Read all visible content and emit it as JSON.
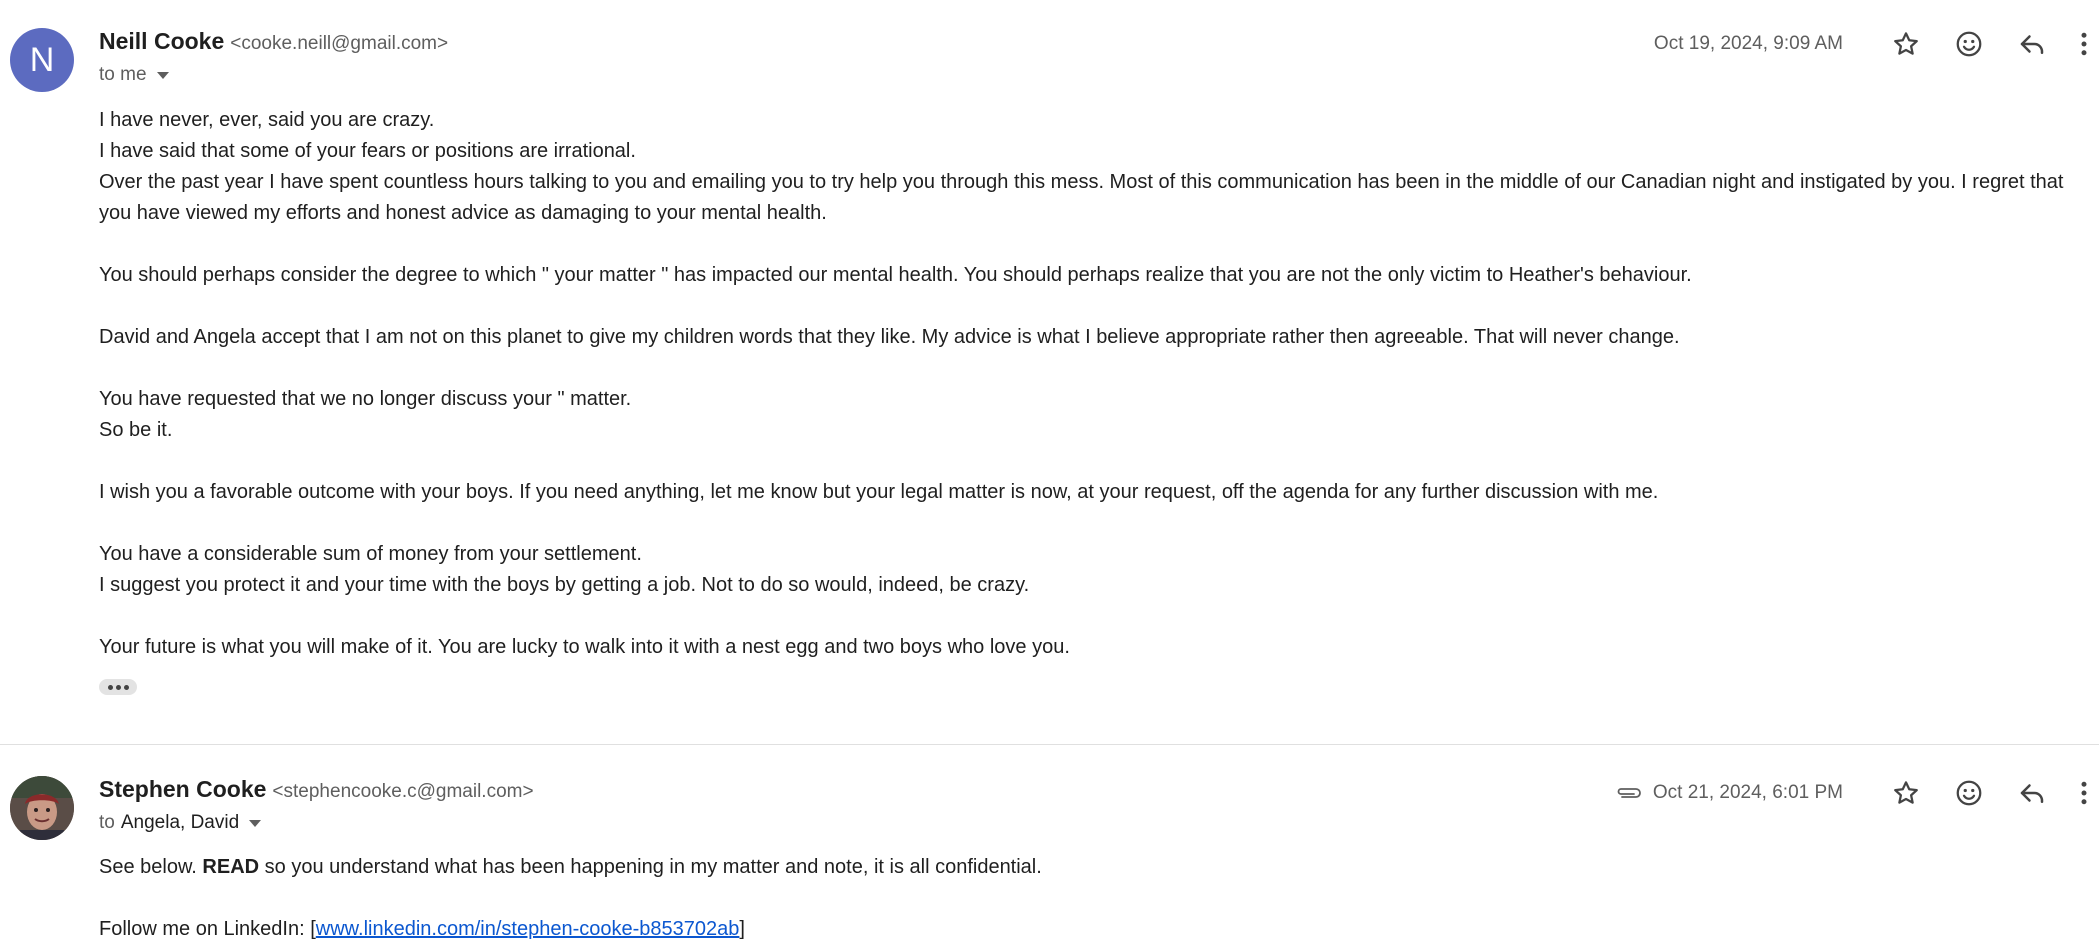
{
  "messages": [
    {
      "avatar_letter": "N",
      "sender_name": "Neill Cooke",
      "sender_email": "<cooke.neill@gmail.com>",
      "to_prefix": "to me",
      "date": "Oct 19, 2024, 9:09 AM",
      "body": {
        "l1": "I have never, ever, said you are crazy.",
        "l2": "I have said that some of your fears or positions are irrational.",
        "l3": "Over the past year I have spent countless hours talking to you and emailing you to try help you through this mess. Most of this communication has been in the middle of our Canadian night and instigated by you. I regret that you have viewed my efforts and honest advice as damaging to your mental health.",
        "l4": "You should perhaps consider the degree to which \" your matter \"  has impacted our mental health.  You should  perhaps realize that you are not the only victim to Heather's behaviour.",
        "l5": "David and Angela accept that I am not on this planet to give my children words that they like. My advice is what I believe appropriate rather then agreeable. That will never change.",
        "l6": "You have requested that we no longer discuss your \" matter.",
        "l7": "So be it.",
        "l8": "I wish you a favorable outcome with your boys. If you need anything, let me know but your legal matter is now, at your request, off the agenda for any further discussion with me.",
        "l9": "You have a considerable sum of money from your settlement.",
        "l10": "I suggest you protect it and your time with the boys by getting a job. Not to do so would, indeed, be crazy.",
        "l11": "Your future is what you will make of it. You are lucky to walk into it with a nest egg and two boys who love you."
      }
    },
    {
      "sender_name": "Stephen Cooke",
      "sender_email": "<stephencooke.c@gmail.com>",
      "to_prefix": "to",
      "to_recipients": "Angela, David",
      "date": "Oct 21, 2024, 6:01 PM",
      "body": {
        "l1_pre": "See below. ",
        "l1_bold": "READ",
        "l1_post": " so you understand what has been happening in my matter and note, it is all confidential.",
        "l2_pre": "Follow me on LinkedIn: [",
        "l2_link": "www.linkedin.com/in/stephen-cooke-b853702ab",
        "l2_post": "]"
      }
    }
  ],
  "icons": {
    "star": "star-icon",
    "emoji": "emoji-icon",
    "reply": "reply-icon",
    "more": "more-vert-icon",
    "attachment": "attachment-icon"
  },
  "colors": {
    "avatar_n": "#5c6bc0",
    "link": "#0b57d0",
    "secondary_text": "#5e5e5e"
  }
}
